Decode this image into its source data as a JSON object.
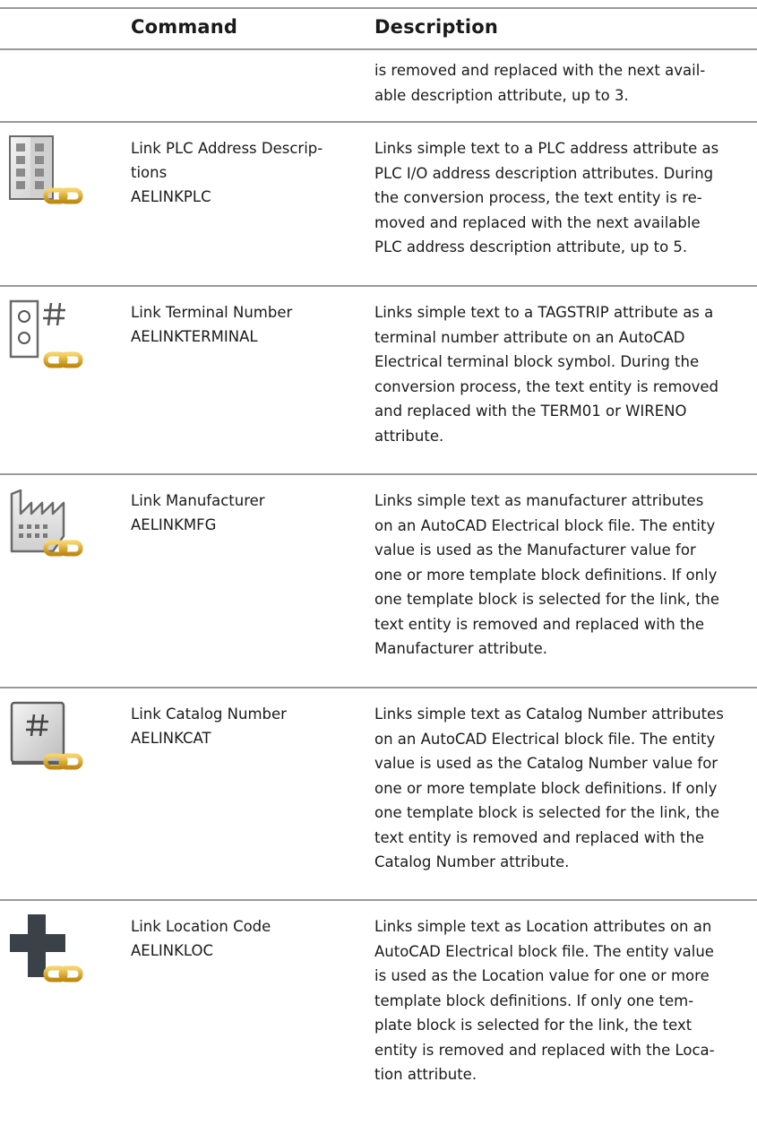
{
  "header": {
    "command": "Command",
    "description": "Description"
  },
  "continuation_lines": [
    "is removed and replaced with the next avail-",
    "able description attribute, up to 3."
  ],
  "rows": [
    {
      "icon": "plc-address-link-icon",
      "command_lines": [
        "Link PLC Address Descrip-",
        "tions",
        "AELINKPLC"
      ],
      "description_lines": [
        "Links simple text to a PLC address attribute as",
        "PLC I/O address description attributes. During",
        "the conversion process, the text entity is re-",
        "moved and replaced with the next available",
        "PLC address description attribute, up to 5."
      ]
    },
    {
      "icon": "terminal-number-link-icon",
      "command_lines": [
        "Link Terminal Number",
        "AELINKTERMINAL"
      ],
      "description_lines": [
        "Links simple text to a TAGSTRIP attribute as a",
        "terminal number attribute on an AutoCAD",
        "Electrical terminal block symbol. During the",
        "conversion process, the text entity is removed",
        "and replaced with the TERM01 or WIRENO",
        "attribute."
      ]
    },
    {
      "icon": "manufacturer-link-icon",
      "command_lines": [
        "Link Manufacturer",
        "AELINKMFG"
      ],
      "description_lines": [
        "Links simple text as manufacturer attributes",
        "on an AutoCAD Electrical block file. The entity",
        "value is used as the Manufacturer value for",
        "one or more template block definitions. If only",
        "one template block is selected for the link, the",
        "text entity is removed and replaced with the",
        "Manufacturer attribute."
      ]
    },
    {
      "icon": "catalog-number-link-icon",
      "command_lines": [
        "Link Catalog Number",
        "AELINKCAT"
      ],
      "description_lines": [
        "Links simple text as Catalog Number attributes",
        "on an AutoCAD Electrical block file. The entity",
        "value is used as the Catalog Number value for",
        "one or more template block definitions. If only",
        "one template block is selected for the link, the",
        "text entity is removed and replaced with the",
        "Catalog Number attribute."
      ]
    },
    {
      "icon": "location-code-link-icon",
      "command_lines": [
        "Link Location Code",
        "AELINKLOC"
      ],
      "description_lines": [
        "Links simple text as Location attributes on an",
        "AutoCAD Electrical block file. The entity value",
        "is used as the Location value for one or more",
        "template block definitions. If only one tem-",
        "plate block is selected for the link, the text",
        "entity is removed and replaced with the Loca-",
        "tion attribute."
      ]
    }
  ]
}
